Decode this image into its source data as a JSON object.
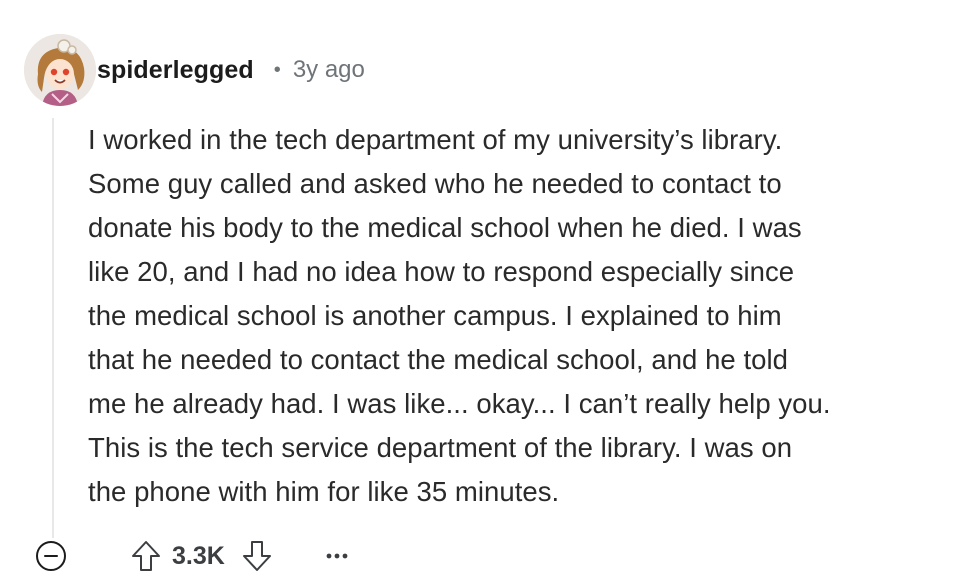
{
  "comment": {
    "author": "spiderlegged",
    "separator": "•",
    "timestamp": "3y ago",
    "body_lines": [
      "I worked in the tech department of my university’s library.",
      "Some guy called and asked who he needed to contact to",
      "donate his body to the medical school when he died. I was",
      "like 20, and I had no idea how to respond especially since",
      "the medical school is another campus. I explained to him",
      "that he needed to contact the medical school, and he told",
      "me he already had. I was like... okay... I can’t really help you.",
      "This is the tech service department of the library. I was on",
      "the phone with him for like 35 minutes."
    ],
    "score": "3.3K"
  },
  "icons": {
    "avatar": "avatar-illustration",
    "collapse": "minus-circle-icon",
    "upvote": "arrow-up-icon",
    "downvote": "arrow-down-icon",
    "more": "ellipsis-icon"
  },
  "colors": {
    "text": "#1c1c1c",
    "meta": "#6f7479",
    "thread_line": "#e6e8ea"
  }
}
